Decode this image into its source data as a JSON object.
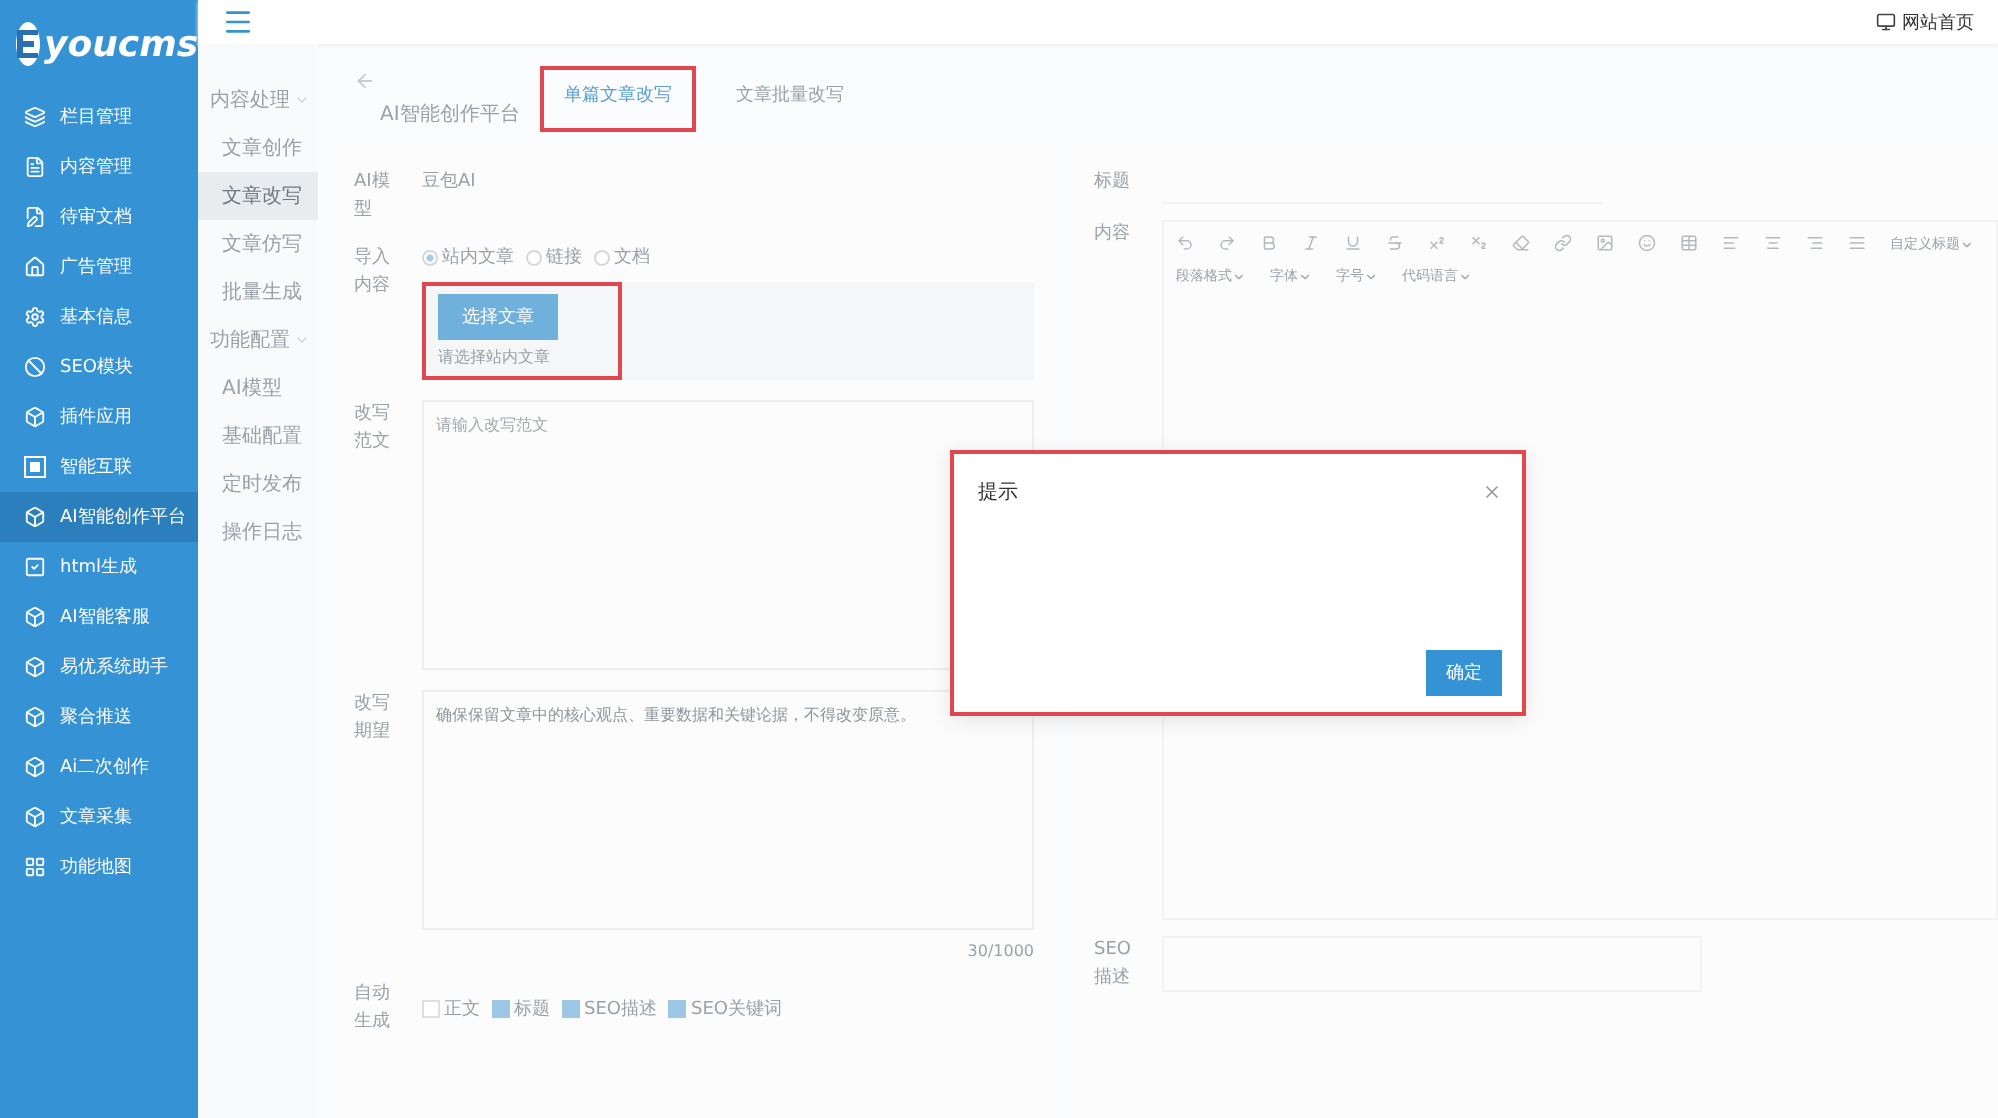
{
  "logo": {
    "text": "youcms"
  },
  "sidebar": {
    "items": [
      {
        "label": "栏目管理",
        "selected": false
      },
      {
        "label": "内容管理",
        "selected": false
      },
      {
        "label": "待审文档",
        "selected": false
      },
      {
        "label": "广告管理",
        "selected": false
      },
      {
        "label": "基本信息",
        "selected": false
      },
      {
        "label": "SEO模块",
        "selected": false
      },
      {
        "label": "插件应用",
        "selected": false
      },
      {
        "label": "智能互联",
        "selected": false
      },
      {
        "label": "AI智能创作平台",
        "selected": true
      },
      {
        "label": "html生成",
        "selected": false
      },
      {
        "label": "AI智能客服",
        "selected": false
      },
      {
        "label": "易优系统助手",
        "selected": false
      },
      {
        "label": "聚合推送",
        "selected": false
      },
      {
        "label": "Ai二次创作",
        "selected": false
      },
      {
        "label": "文章采集",
        "selected": false
      },
      {
        "label": "功能地图",
        "selected": false
      }
    ]
  },
  "topbar": {
    "site_link": "网站首页"
  },
  "submenu": [
    {
      "label": "内容处理",
      "children": [
        {
          "label": "文章创作",
          "selected": false
        },
        {
          "label": "文章改写",
          "selected": true
        },
        {
          "label": "文章仿写",
          "selected": false
        },
        {
          "label": "批量生成",
          "selected": false
        }
      ]
    },
    {
      "label": "功能配置",
      "children": [
        {
          "label": "AI模型",
          "selected": false
        },
        {
          "label": "基础配置",
          "selected": false
        },
        {
          "label": "定时发布",
          "selected": false
        },
        {
          "label": "操作日志",
          "selected": false
        }
      ]
    }
  ],
  "header": {
    "title": "AI智能创作平台",
    "tabs": [
      {
        "label": "单篇文章改写",
        "selected": true,
        "highlighted": true
      },
      {
        "label": "文章批量改写",
        "selected": false,
        "highlighted": false
      }
    ]
  },
  "form": {
    "ai_model": {
      "label": "AI模型",
      "value": "豆包AI"
    },
    "import": {
      "label": "导入内容",
      "options": [
        {
          "label": "站内文章",
          "selected": true
        },
        {
          "label": "链接",
          "selected": false
        },
        {
          "label": "文档",
          "selected": false
        }
      ],
      "button": "选择文章",
      "hint": "请选择站内文章",
      "highlighted": true
    },
    "sample": {
      "label": "改写范文",
      "placeholder": "请输入改写范文"
    },
    "expectation": {
      "label": "改写期望",
      "value": "确保保留文章中的核心观点、重要数据和关键论据，不得改变原意。",
      "count": "30/1000"
    },
    "auto": {
      "label": "自动生成",
      "options": [
        {
          "label": "正文",
          "checked": false
        },
        {
          "label": "标题",
          "checked": true
        },
        {
          "label": "SEO描述",
          "checked": true
        },
        {
          "label": "SEO关键词",
          "checked": true
        }
      ]
    }
  },
  "editor": {
    "title_label": "标题",
    "content_label": "内容",
    "selects": [
      "自定义标题",
      "段落格式",
      "字体",
      "字号",
      "代码语言"
    ],
    "seo_label": "SEO描述"
  },
  "dialog": {
    "title": "提示",
    "button": "确定",
    "highlighted": true
  }
}
